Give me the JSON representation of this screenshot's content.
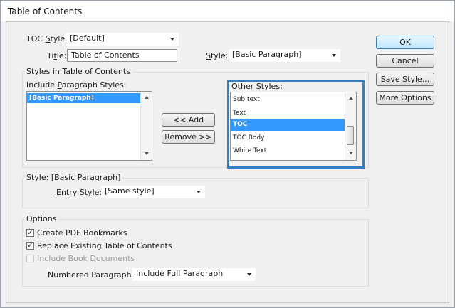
{
  "window": {
    "title": "Table of Contents"
  },
  "toc_style": {
    "label": "TOC Style:",
    "value": "[Default]"
  },
  "title_row": {
    "label": "Title:",
    "value": "Table of Contents"
  },
  "style_row": {
    "label": "Style:",
    "value": "[Basic Paragraph]"
  },
  "styles_group": {
    "title": "Styles in Table of Contents",
    "include_label": "Include Paragraph Styles:",
    "include_items": [
      "[Basic Paragraph]"
    ],
    "other_label": "Other Styles:",
    "other_items": [
      "Sub text",
      "Text",
      "TOC",
      "TOC Body",
      "White Text"
    ],
    "other_selected": "TOC"
  },
  "buttons": {
    "add": "<< Add",
    "remove": "Remove >>",
    "ok": "OK",
    "cancel": "Cancel",
    "save_style": "Save Style...",
    "more_options": "More Options"
  },
  "style_group": {
    "title": "Style: [Basic Paragraph]",
    "entry_label": "Entry Style:",
    "entry_value": "[Same style]"
  },
  "options": {
    "title": "Options",
    "create_pdf": {
      "label": "Create PDF Bookmarks",
      "checked": true
    },
    "replace_existing": {
      "label": "Replace Existing Table of Contents",
      "checked": true
    },
    "include_book": {
      "label": "Include Book Documents",
      "checked": false,
      "disabled": true
    },
    "numbered_label": "Numbered Paragraphs:",
    "numbered_value": "Include Full Paragraph"
  },
  "colors": {
    "selection": "#3399ff",
    "highlight_border": "#2f80c8",
    "primary_button": "#bee6fd"
  }
}
